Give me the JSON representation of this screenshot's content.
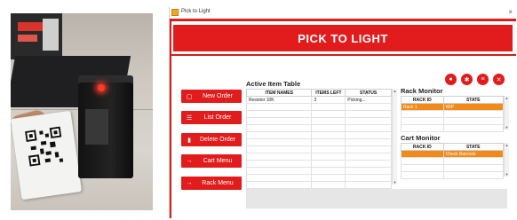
{
  "window": {
    "title": "Pick to Light",
    "close_glyph": "×"
  },
  "banner": {
    "title": "PICK TO LIGHT"
  },
  "menu": [
    {
      "label": "New Order",
      "icon": "new-order-icon",
      "glyph": "▢"
    },
    {
      "label": "List Order",
      "icon": "list-icon",
      "glyph": "☰"
    },
    {
      "label": "Delete Order",
      "icon": "trash-icon",
      "glyph": "▮"
    },
    {
      "label": "Cart Menu",
      "icon": "arrow-right-icon",
      "glyph": "→"
    },
    {
      "label": "Rack Menu",
      "icon": "arrow-right-icon",
      "glyph": "→"
    }
  ],
  "header_icons": [
    {
      "name": "user-icon",
      "glyph": "●"
    },
    {
      "name": "settings-icon",
      "glyph": "✱"
    },
    {
      "name": "database-icon",
      "glyph": "≡"
    },
    {
      "name": "close-circle-icon",
      "glyph": "✕"
    }
  ],
  "active_items": {
    "title": "Active Item Table",
    "columns": [
      "ITEM NAMES",
      "ITEMS LEFT",
      "STATUS"
    ],
    "rows": [
      [
        "Resistor 10K",
        "3",
        "Picking..."
      ]
    ]
  },
  "rack_monitor": {
    "title": "Rack Monitor",
    "columns": [
      "RACK ID",
      "STATE"
    ],
    "rows": [
      [
        "Rack 1",
        "WIP"
      ]
    ]
  },
  "cart_monitor": {
    "title": "Cart Monitor",
    "columns": [
      "RACK ID",
      "STATE"
    ],
    "rows": [
      [
        "",
        "Check Barcode"
      ]
    ]
  },
  "colors": {
    "accent": "#e21c1c",
    "highlight": "#f28a1a",
    "footer": "#e6e6e6"
  }
}
